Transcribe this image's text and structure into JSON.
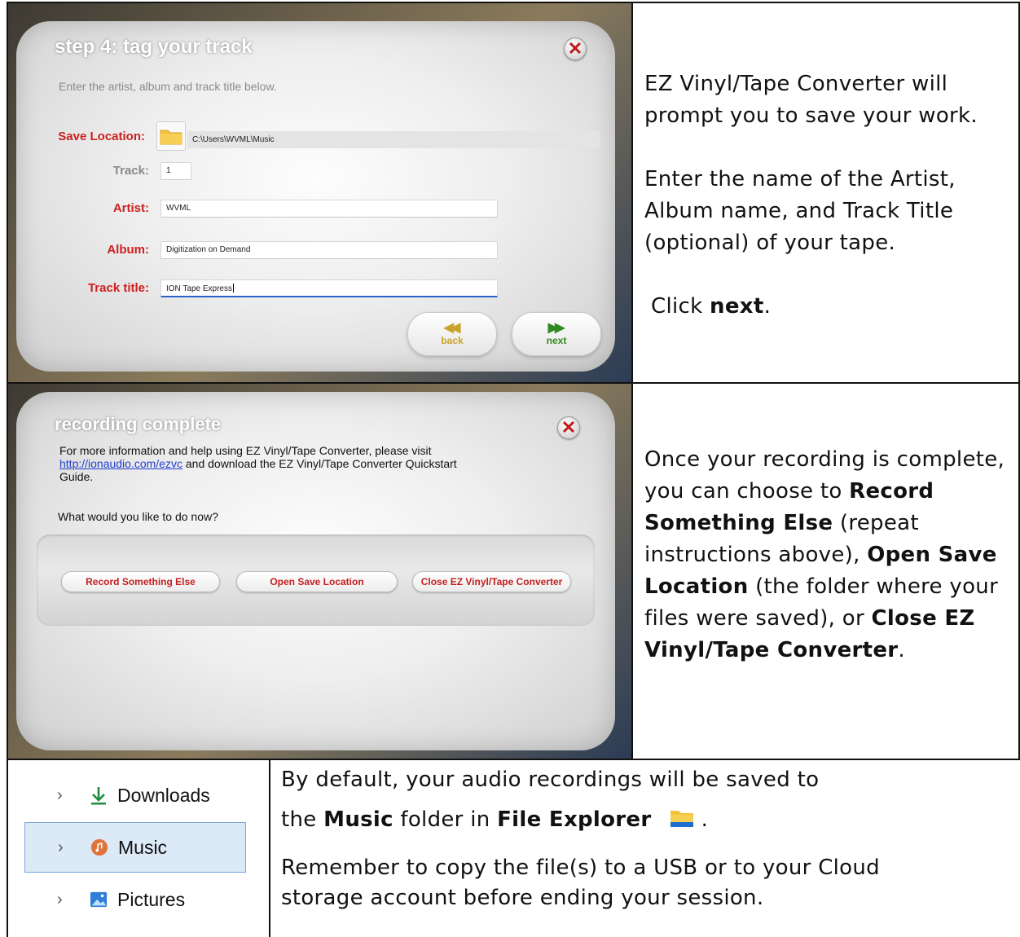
{
  "tag_dialog": {
    "title": "step 4: tag your track",
    "close_glyph": "✕",
    "instructions": "Enter the artist, album and track title below.",
    "save_location_label": "Save Location:",
    "save_location_path": "C:\\Users\\WVML\\Music",
    "track_label": "Track:",
    "track_value": "1",
    "artist_label": "Artist:",
    "artist_value": "WVML",
    "album_label": "Album:",
    "album_value": "Digitization on Demand",
    "track_title_label": "Track title:",
    "track_title_value": "ION Tape Express",
    "back_label": "back",
    "next_label": "next",
    "back_icon": "rewind-icon",
    "next_icon": "fast-forward-icon"
  },
  "tag_instructions": {
    "para1": "EZ Vinyl/Tape Converter will prompt you to save your work.",
    "para2": "Enter the name of the Artist, Album name, and Track Title (optional) of your tape.",
    "click_prefix": "Click ",
    "click_bold": "next",
    "click_suffix": "."
  },
  "complete_dialog": {
    "title": "recording complete",
    "close_glyph": "✕",
    "info_line1": "For more information and help using EZ Vinyl/Tape Converter, please visit",
    "info_link": "http://ionaudio.com/ezvc",
    "info_line2": " and download the EZ Vinyl/Tape Converter Quickstart",
    "info_line3": "Guide.",
    "question": "What would you like to do now?",
    "btn_record": "Record Something Else",
    "btn_open": "Open Save Location",
    "btn_close": "Close EZ Vinyl/Tape Converter"
  },
  "complete_instructions": {
    "t1": "Once your recording is complete, you can choose to ",
    "b1": "Record Something Else",
    "t2": " (repeat instructions above), ",
    "b2": "Open Save Location",
    "t3": " (the folder where your files were saved), or ",
    "b3": "Close EZ Vinyl/Tape Converter",
    "t4": "."
  },
  "explorer": {
    "items": [
      {
        "label": "Downloads",
        "icon": "download-arrow-icon"
      },
      {
        "label": "Music",
        "icon": "music-note-icon"
      },
      {
        "label": "Pictures",
        "icon": "pictures-icon"
      }
    ]
  },
  "default_save": {
    "line1": "By default, your audio recordings will be saved to",
    "the": "the ",
    "music": "Music",
    "folder_in": " folder in ",
    "file_explorer": "File Explorer",
    "after_icon": " .",
    "para2": "Remember to copy the file(s) to a USB or to your Cloud storage account before ending your session."
  },
  "colors": {
    "label_red": "#cc1f1f",
    "link_blue": "#1f3fcf",
    "selection_blue": "#dce9f7",
    "folder_yellow": "#f3c23d"
  }
}
